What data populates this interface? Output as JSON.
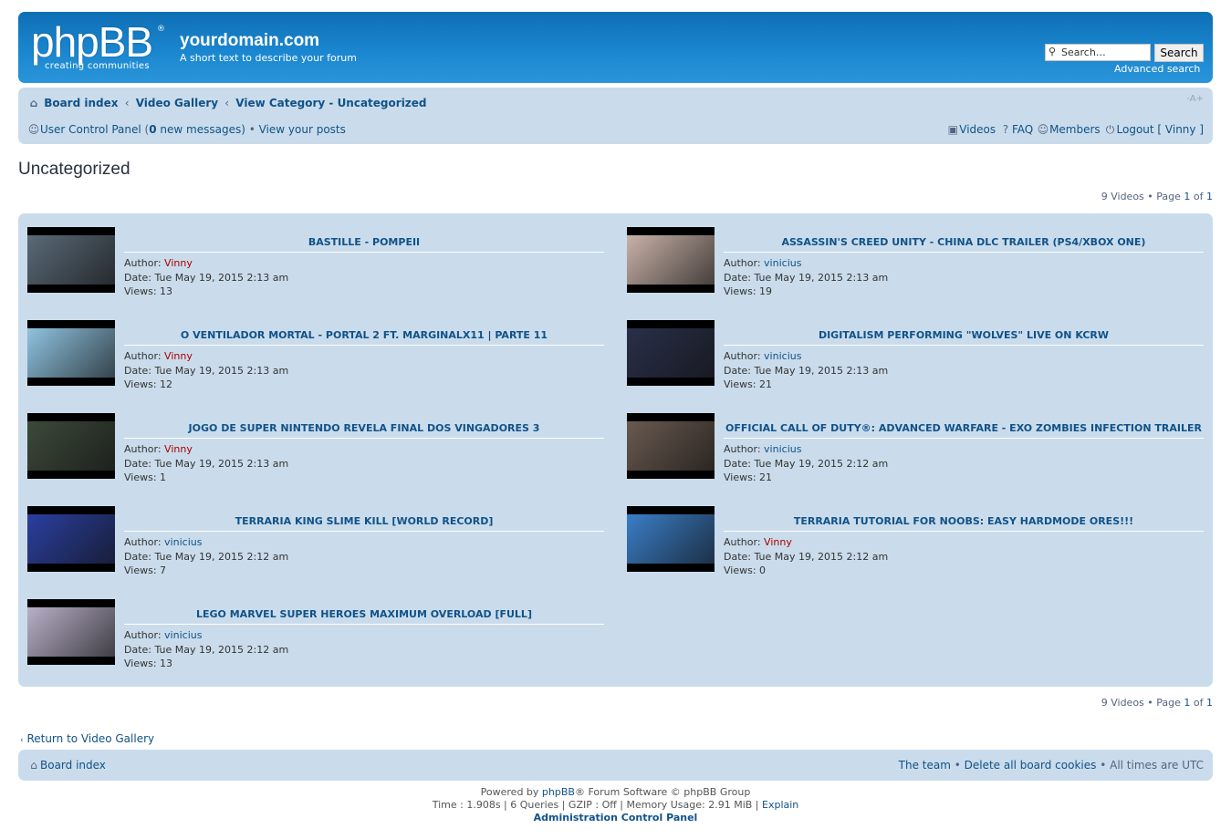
{
  "header": {
    "logo_text": "phpBB",
    "logo_reg": "®",
    "logo_tagline": "creating   communities",
    "site_name": "yourdomain.com",
    "site_description": "A short text to describe your forum",
    "search_placeholder": "Search…",
    "search_button": "Search",
    "advanced_search": "Advanced search"
  },
  "breadcrumbs": {
    "board_index": "Board index",
    "video_gallery": "Video Gallery",
    "view_category": "View Category - Uncategorized",
    "sep": "‹"
  },
  "font_size_toggle": "-A+",
  "navbar": {
    "ucp": "User Control Panel",
    "new_messages_open": " (",
    "new_messages_count": "0",
    "new_messages_close": " new messages)",
    "bullet": " • ",
    "view_posts": "View your posts",
    "videos": "Videos",
    "faq": "FAQ",
    "members": "Members",
    "logout": "Logout [ Vinny ]"
  },
  "page_title": "Uncategorized",
  "pagination": {
    "prefix": "9 Videos • Page ",
    "current": "1",
    "of": " of ",
    "total": "1"
  },
  "labels": {
    "author": "Author: ",
    "date": "Date: ",
    "views": "Views: "
  },
  "videos": [
    {
      "title": "BASTILLE - POMPEII",
      "author": "Vinny",
      "date": "Tue May 19, 2015 2:13 am",
      "views": "13",
      "thumb_color": "#5a6a78"
    },
    {
      "title": "ASSASSIN'S CREED UNITY - CHINA DLC TRAILER (PS4/XBOX ONE)",
      "author": "vinicius",
      "date": "Tue May 19, 2015 2:13 am",
      "views": "19",
      "thumb_color": "#c9b2a8"
    },
    {
      "title": "O VENTILADOR MORTAL - PORTAL 2 FT. MARGINALX11 | PARTE 11",
      "author": "Vinny",
      "date": "Tue May 19, 2015 2:13 am",
      "views": "12",
      "thumb_color": "#8fc3e0"
    },
    {
      "title": "DIGITALISM PERFORMING \"WOLVES\" LIVE ON KCRW",
      "author": "vinicius",
      "date": "Tue May 19, 2015 2:13 am",
      "views": "21",
      "thumb_color": "#2a2f4a"
    },
    {
      "title": "JOGO DE SUPER NINTENDO REVELA FINAL DOS VINGADORES 3",
      "author": "Vinny",
      "date": "Tue May 19, 2015 2:13 am",
      "views": "1",
      "thumb_color": "#3c4a3a"
    },
    {
      "title": "OFFICIAL CALL OF DUTY®: ADVANCED WARFARE - EXO ZOMBIES INFECTION TRAILER",
      "author": "vinicius",
      "date": "Tue May 19, 2015 2:12 am",
      "views": "21",
      "thumb_color": "#6a5a50"
    },
    {
      "title": "TERRARIA KING SLIME KILL [WORLD RECORD]",
      "author": "vinicius",
      "date": "Tue May 19, 2015 2:12 am",
      "views": "7",
      "thumb_color": "#2a3fa0"
    },
    {
      "title": "TERRARIA TUTORIAL FOR NOOBS: EASY HARDMODE ORES!!!",
      "author": "Vinny",
      "date": "Tue May 19, 2015 2:12 am",
      "views": "0",
      "thumb_color": "#3a7ec8"
    },
    {
      "title": "LEGO MARVEL SUPER HEROES MAXIMUM OVERLOAD [FULL]",
      "author": "vinicius",
      "date": "Tue May 19, 2015 2:12 am",
      "views": "13",
      "thumb_color": "#b8b0c8"
    }
  ],
  "return_link": "Return to Video Gallery",
  "footer": {
    "board_index": "Board index",
    "the_team": "The team",
    "sep": " • ",
    "delete_cookies": "Delete all board cookies",
    "times": "All times are UTC"
  },
  "copyright": {
    "powered_pre": "Powered by ",
    "phpbb": "phpBB",
    "powered_post": "® Forum Software © phpBB Group",
    "stats": "Time : 1.908s | 6 Queries | GZIP : Off | Memory Usage: 2.91 MiB | ",
    "explain": "Explain",
    "acp": "Administration Control Panel"
  },
  "colors": {
    "header_blue": "#1a86cf",
    "panel_bg": "#cadceb",
    "link": "#105289",
    "admin_red": "#aa0000"
  }
}
